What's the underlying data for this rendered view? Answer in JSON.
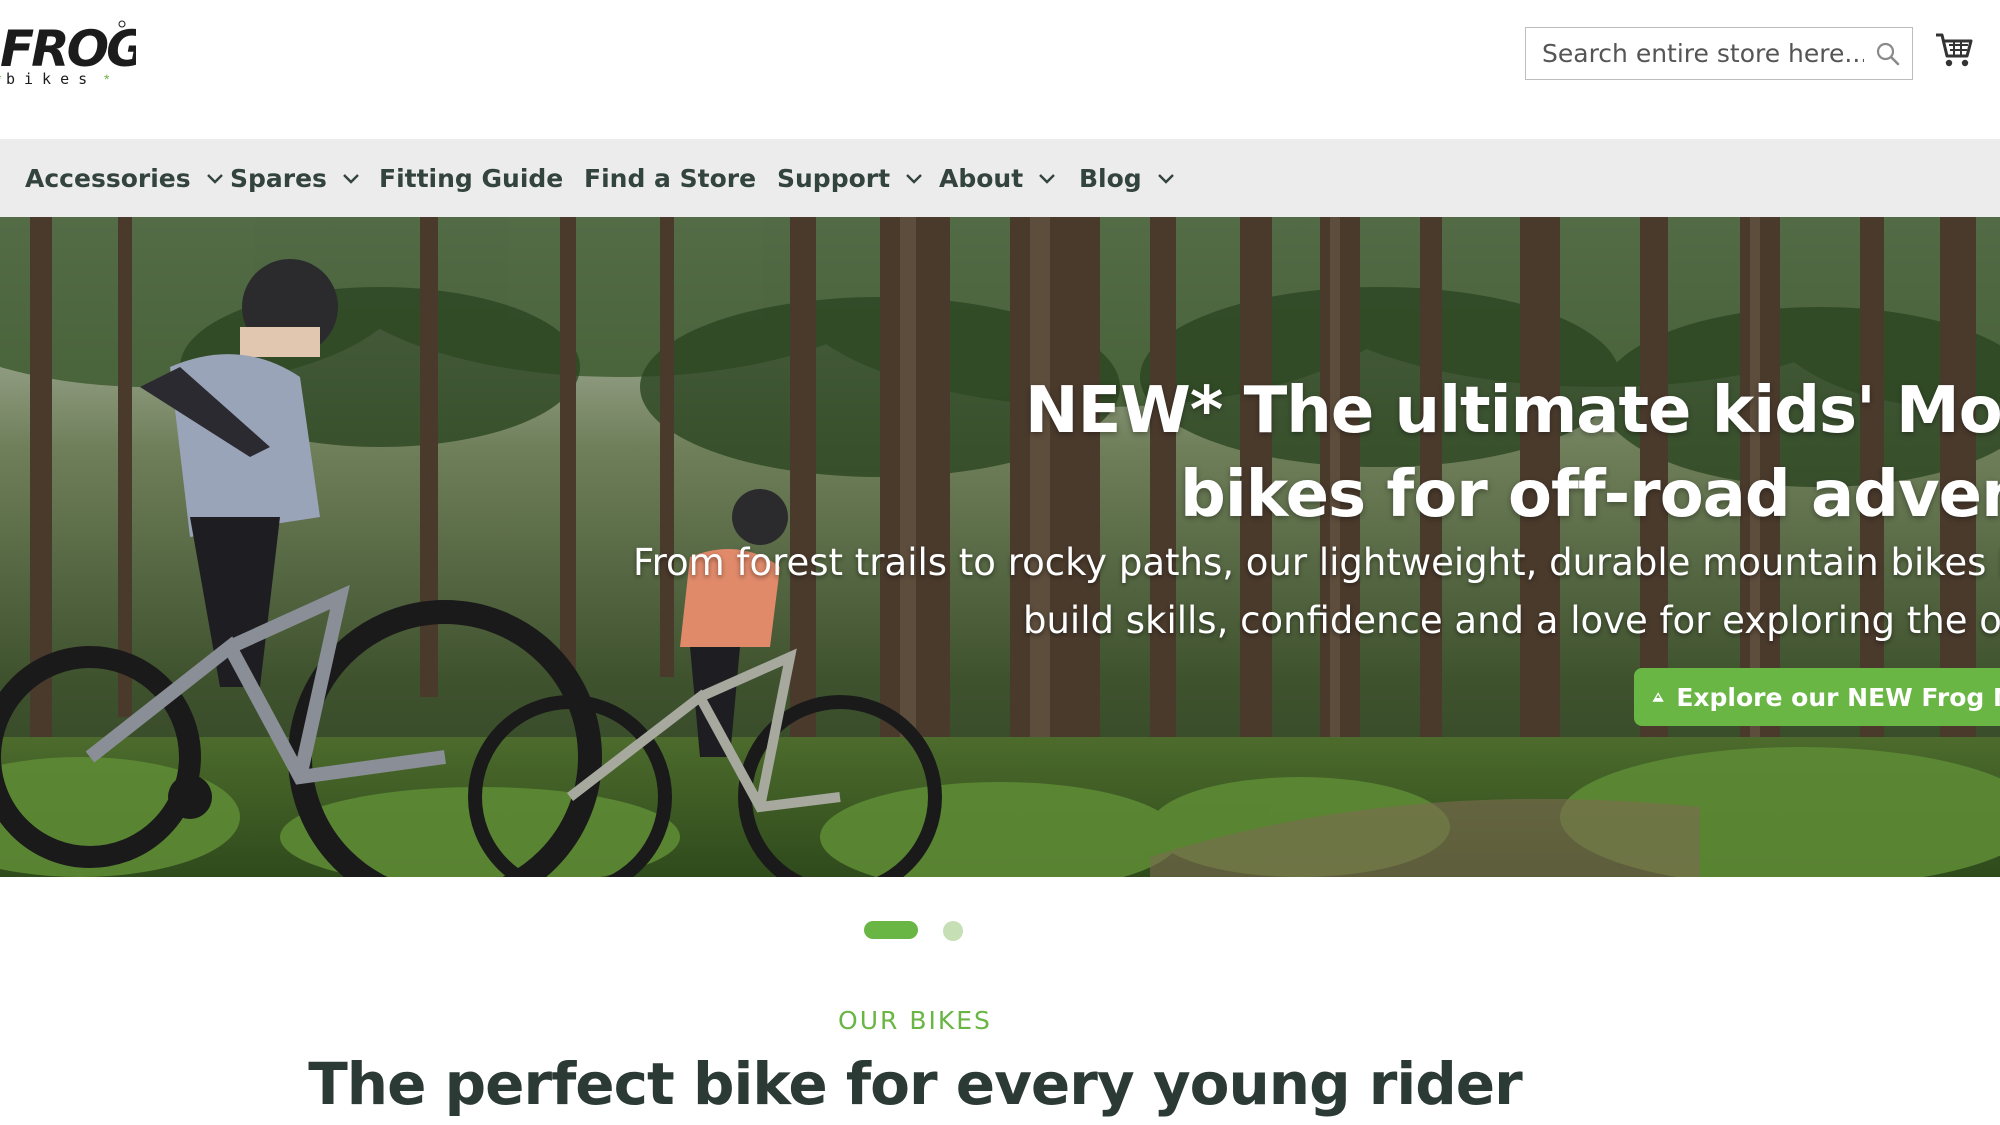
{
  "brand": {
    "logo_text": "FROG",
    "logo_subtext": "bikes"
  },
  "search": {
    "placeholder": "Search entire store here..."
  },
  "header": {
    "cart_icon": "cart-icon",
    "search_icon": "search-icon"
  },
  "nav": {
    "items": [
      {
        "label": "Accessories",
        "has_dropdown": true
      },
      {
        "label": "Spares",
        "has_dropdown": true
      },
      {
        "label": "Fitting Guide",
        "has_dropdown": false
      },
      {
        "label": "Find a Store",
        "has_dropdown": false
      },
      {
        "label": "Support",
        "has_dropdown": true
      },
      {
        "label": "About",
        "has_dropdown": true
      },
      {
        "label": "Blog",
        "has_dropdown": true
      }
    ]
  },
  "hero": {
    "title_line1": "NEW* The ultimate kids' Mountain",
    "title_line2": "bikes for off-road adventures",
    "subtitle_line1": "From forest trails to rocky paths, our lightweight, durable mountain bikes help",
    "subtitle_line2": "build skills, confidence and a love for exploring the outdoors",
    "cta_label": "Explore our NEW Frog MTB",
    "cta_icon": "mountain-icon",
    "slide_count": 2,
    "active_slide": 1
  },
  "section": {
    "eyebrow": "OUR BIKES",
    "title": "The perfect bike for every young rider"
  },
  "colors": {
    "accent_green": "#6ab645",
    "nav_background": "#ececec",
    "heading_text": "#2c3a36"
  }
}
